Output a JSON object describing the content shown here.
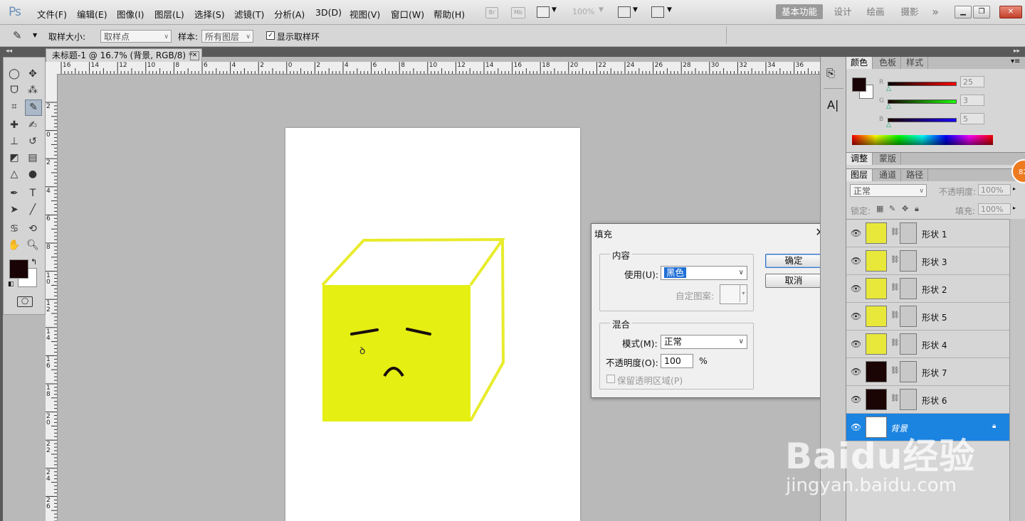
{
  "app": {
    "logo": "Ps"
  },
  "menu": [
    "文件(F)",
    "编辑(E)",
    "图像(I)",
    "图层(L)",
    "选择(S)",
    "滤镜(T)",
    "分析(A)",
    "3D(D)",
    "视图(V)",
    "窗口(W)",
    "帮助(H)"
  ],
  "appbar": {
    "br": "Br",
    "mb": "Mb",
    "zoom": "100%"
  },
  "workspaces": [
    "基本功能",
    "设计",
    "绘画",
    "摄影"
  ],
  "workspaces_more": "»",
  "options": {
    "sample_size_label": "取样大小:",
    "sample_size_value": "取样点",
    "sample_label": "样本:",
    "sample_value": "所有图层",
    "show_ring_label": "显示取样环"
  },
  "document": {
    "tab_title": "未标题-1 @ 16.7% (背景, RGB/8) *"
  },
  "ruler_top": [
    "16",
    "14",
    "12",
    "10",
    "8",
    "6",
    "4",
    "2",
    "0",
    "2",
    "4",
    "6",
    "8",
    "10",
    "12",
    "14",
    "16",
    "18",
    "20",
    "22",
    "24",
    "26",
    "28",
    "30",
    "32",
    "34",
    "36"
  ],
  "ruler_left": [
    "2",
    "0",
    "2",
    "4",
    "6",
    "8",
    "1 0",
    "1 2",
    "1 4",
    "1 6",
    "1 8",
    "2 0",
    "2 2",
    "2 4",
    "2 6"
  ],
  "fill_dialog": {
    "title": "填充",
    "content_group": "内容",
    "use_label": "使用(U):",
    "use_value": "黑色",
    "custom_pattern_label": "自定图案:",
    "blend_group": "混合",
    "mode_label": "模式(M):",
    "mode_value": "正常",
    "opacity_label": "不透明度(O):",
    "opacity_value": "100",
    "opacity_unit": "%",
    "preserve_label": "保留透明区域(P)",
    "ok_label": "确定",
    "cancel_label": "取消"
  },
  "color_panel": {
    "tabs": [
      "颜色",
      "色板",
      "样式"
    ],
    "r_label": "R",
    "r_value": "25",
    "g_label": "G",
    "g_value": "3",
    "b_label": "B",
    "b_value": "5"
  },
  "adjust_tabs": [
    "调整",
    "蒙版"
  ],
  "layers_panel": {
    "tabs": [
      "图层",
      "通道",
      "路径"
    ],
    "blend_mode": "正常",
    "opacity_label": "不透明度:",
    "opacity_value": "100%",
    "lock_label": "锁定:",
    "fill_label": "填充:",
    "fill_value": "100%",
    "layers": [
      {
        "name": "形状 1",
        "color": "#e8e83a"
      },
      {
        "name": "形状 3",
        "color": "#e8e83a"
      },
      {
        "name": "形状 2",
        "color": "#e8e83a"
      },
      {
        "name": "形状 5",
        "color": "#e8e83a"
      },
      {
        "name": "形状 4",
        "color": "#e8e83a"
      },
      {
        "name": "形状 7",
        "color": "#1a0404"
      },
      {
        "name": "形状 6",
        "color": "#1a0404"
      },
      {
        "name": "背景",
        "color": "#ffffff"
      }
    ]
  },
  "badge": "82",
  "watermark": {
    "logo": "Baidu经验",
    "url": "jingyan.baidu.com"
  },
  "colors": {
    "foreground": "#190305",
    "cube_yellow": "#e5ef11",
    "selection": "#1b83e0"
  }
}
